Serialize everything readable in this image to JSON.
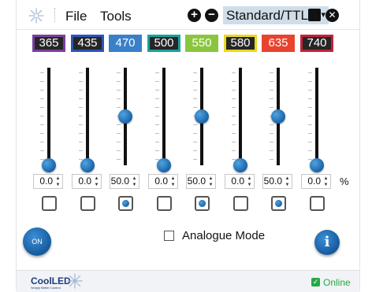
{
  "menu": {
    "file": "File",
    "tools": "Tools"
  },
  "title_bar": {
    "add_label": "+",
    "remove_label": "−",
    "mode": "Standard/TTL",
    "close_label": "✕"
  },
  "channels": [
    {
      "wavelength": "365",
      "bg": "#262626",
      "border": "#7b3fa0",
      "level": "0.0",
      "checked": false
    },
    {
      "wavelength": "435",
      "bg": "#262626",
      "border": "#2b55b8",
      "level": "0.0",
      "checked": false
    },
    {
      "wavelength": "470",
      "bg": "#3a80c9",
      "border": "#3a80c9",
      "level": "50.0",
      "checked": true
    },
    {
      "wavelength": "500",
      "bg": "#262626",
      "border": "#17a39a",
      "level": "0.0",
      "checked": false
    },
    {
      "wavelength": "550",
      "bg": "#8bc53f",
      "border": "#8bc53f",
      "level": "50.0",
      "checked": true
    },
    {
      "wavelength": "580",
      "bg": "#262626",
      "border": "#e8d91f",
      "level": "0.0",
      "checked": false
    },
    {
      "wavelength": "635",
      "bg": "#e8432e",
      "border": "#e8432e",
      "level": "50.0",
      "checked": true
    },
    {
      "wavelength": "740",
      "bg": "#262626",
      "border": "#c2233a",
      "level": "0.0",
      "checked": false
    }
  ],
  "unit_label": "%",
  "controls": {
    "on_label": "ON",
    "analogue_label": "Analogue Mode",
    "analogue_checked": false,
    "info_label": "i"
  },
  "footer": {
    "brand": "CoolLED",
    "tagline": "Simply Better Control",
    "status": "Online",
    "status_color": "#27a845"
  },
  "colors": {
    "accent": "#1a63a8",
    "mode_select_bg": "#cfdde9"
  }
}
